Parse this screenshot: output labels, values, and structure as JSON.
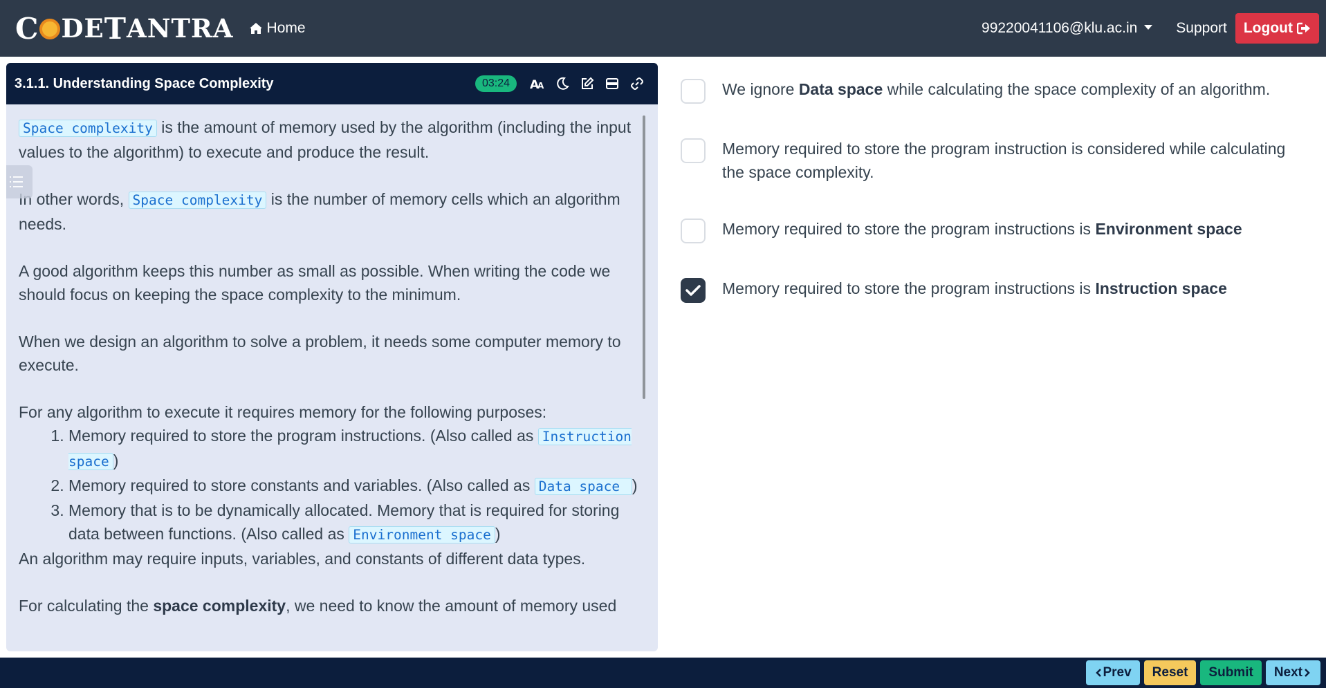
{
  "navbar": {
    "logo_parts": [
      "C",
      "DE",
      "T",
      "ANTRA"
    ],
    "logo_alt": "CODETANTRA",
    "home_label": "Home",
    "user_email": "99220041106@klu.ac.in",
    "support_label": "Support",
    "logout_label": "Logout"
  },
  "lesson": {
    "title": "3.1.1. Understanding Space Complexity",
    "timer": "03:24",
    "tools": [
      "font-size-icon",
      "dark-mode-icon",
      "edit-icon",
      "layout-icon",
      "link-icon"
    ],
    "p1_code": "Space complexity",
    "p1_text": " is the amount of memory used by the algorithm (including the input values to the algorithm) to execute and produce the result.",
    "p2_text_a": "In other words, ",
    "p2_code": "Space complexity",
    "p2_text_b": " is the number of memory cells which an algorithm needs.",
    "p3_text": "A good algorithm keeps this number as small as possible. When writing the code we should focus on keeping the space complexity to the minimum.",
    "p4_text": "When we design an algorithm to solve a problem, it needs some computer memory to execute.",
    "p5_text": "For any algorithm to execute it requires memory for the following purposes:",
    "list": [
      {
        "text": "Memory required to store the program instructions. (Also called as ",
        "code": "Instruction space",
        "tail": ")"
      },
      {
        "text": "Memory required to store constants and variables. (Also called as ",
        "code": "Data space ",
        "tail": ")"
      },
      {
        "text": "Memory that is to be dynamically allocated. Memory that is required for storing data between functions. (Also called as ",
        "code": "Environment space",
        "tail": ")"
      }
    ],
    "p6_text": "An algorithm may require inputs, variables, and constants of different data types.",
    "p7_text_a": "For calculating the ",
    "p7_bold": "space complexity",
    "p7_text_b": ", we need to know the amount of memory used"
  },
  "options": [
    {
      "checked": false,
      "pre": "We ignore ",
      "bold": "Data space",
      "post": " while calculating the space complexity of an algorithm."
    },
    {
      "checked": false,
      "pre": "Memory required to store the program instruction is considered while calculating the space complexity.",
      "bold": "",
      "post": ""
    },
    {
      "checked": false,
      "pre": "Memory required to store the program instructions is ",
      "bold": "Environment space",
      "post": ""
    },
    {
      "checked": true,
      "pre": "Memory required to store the program instructions is ",
      "bold": "Instruction space",
      "post": ""
    }
  ],
  "footer": {
    "prev_label": "Prev",
    "reset_label": "Reset",
    "submit_label": "Submit",
    "next_label": "Next"
  },
  "colors": {
    "navbar": "#2e3a4a",
    "panel_header": "#0c1e3d",
    "panel_bg": "#e2e7f4",
    "timer": "#19b77e",
    "logout": "#dc3545",
    "prev_next": "#7fd3f2",
    "reset": "#f5c95c",
    "submit": "#19b77e"
  }
}
